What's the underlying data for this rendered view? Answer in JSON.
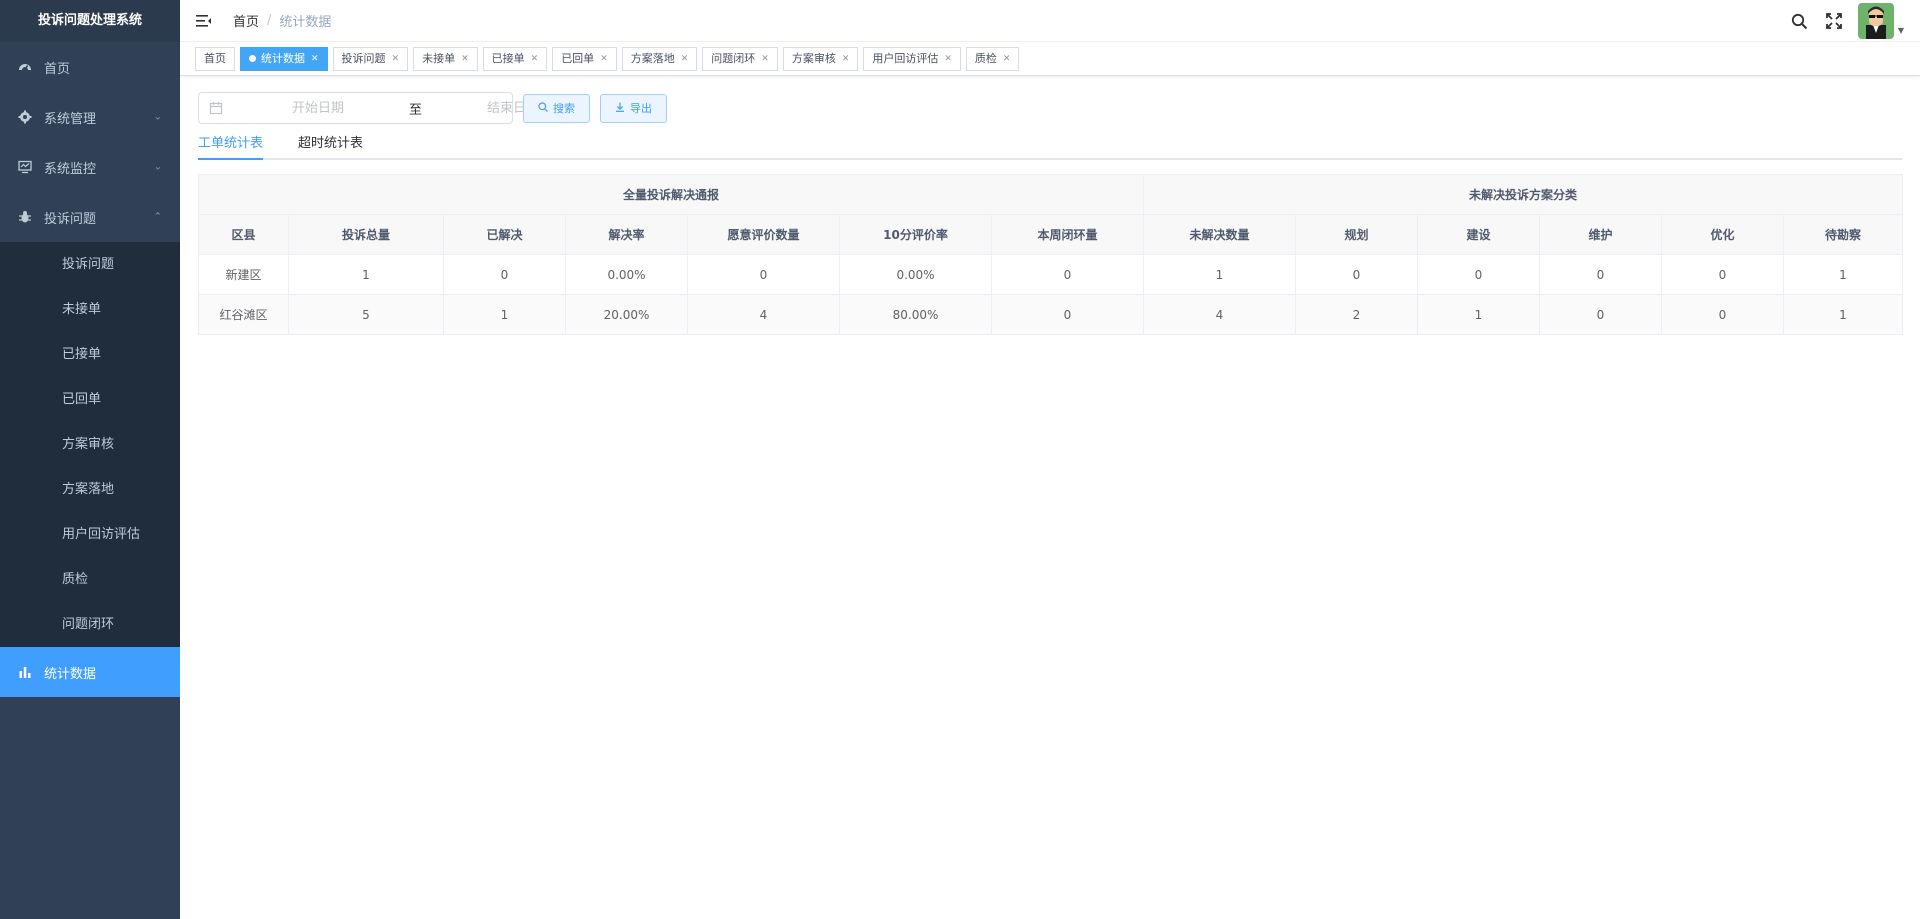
{
  "app": {
    "title": "投诉问题处理系统"
  },
  "sidebar": {
    "items": [
      {
        "label": "首页",
        "icon": "dashboard-icon"
      },
      {
        "label": "系统管理",
        "icon": "gear-icon"
      },
      {
        "label": "系统监控",
        "icon": "monitor-icon"
      },
      {
        "label": "投诉问题",
        "icon": "bug-icon"
      }
    ],
    "sub_items": [
      {
        "label": "投诉问题"
      },
      {
        "label": "未接单"
      },
      {
        "label": "已接单"
      },
      {
        "label": "已回单"
      },
      {
        "label": "方案审核"
      },
      {
        "label": "方案落地"
      },
      {
        "label": "用户回访评估"
      },
      {
        "label": "质检"
      },
      {
        "label": "问题闭环"
      }
    ],
    "active_item": {
      "label": "统计数据",
      "icon": "bar-chart-icon"
    }
  },
  "header": {
    "breadcrumb": {
      "home": "首页",
      "separator": "/",
      "current": "统计数据"
    }
  },
  "tags": [
    {
      "label": "首页",
      "closable": false,
      "active": false
    },
    {
      "label": "统计数据",
      "closable": true,
      "active": true
    },
    {
      "label": "投诉问题",
      "closable": true,
      "active": false
    },
    {
      "label": "未接单",
      "closable": true,
      "active": false
    },
    {
      "label": "已接单",
      "closable": true,
      "active": false
    },
    {
      "label": "已回单",
      "closable": true,
      "active": false
    },
    {
      "label": "方案落地",
      "closable": true,
      "active": false
    },
    {
      "label": "问题闭环",
      "closable": true,
      "active": false
    },
    {
      "label": "方案审核",
      "closable": true,
      "active": false
    },
    {
      "label": "用户回访评估",
      "closable": true,
      "active": false
    },
    {
      "label": "质检",
      "closable": true,
      "active": false
    }
  ],
  "filter": {
    "start_placeholder": "开始日期",
    "range_separator": "至",
    "end_placeholder": "结束日期",
    "search_label": "搜索",
    "export_label": "导出"
  },
  "tabs": [
    {
      "label": "工单统计表",
      "active": true
    },
    {
      "label": "超时统计表",
      "active": false
    }
  ],
  "table": {
    "group_headers": [
      {
        "label": "全量投诉解决通报",
        "colspan": 7
      },
      {
        "label": "未解决投诉方案分类",
        "colspan": 6
      }
    ],
    "columns": [
      "区县",
      "投诉总量",
      "已解决",
      "解决率",
      "愿意评价数量",
      "10分评价率",
      "本周闭环量",
      "未解决数量",
      "规划",
      "建设",
      "维护",
      "优化",
      "待勘察"
    ],
    "rows": [
      [
        "新建区",
        "1",
        "0",
        "0.00%",
        "0",
        "0.00%",
        "0",
        "1",
        "0",
        "0",
        "0",
        "0",
        "1"
      ],
      [
        "红谷滩区",
        "5",
        "1",
        "20.00%",
        "4",
        "80.00%",
        "0",
        "4",
        "2",
        "1",
        "0",
        "0",
        "1"
      ]
    ]
  },
  "colors": {
    "sidebar_bg": "#304156",
    "submenu_bg": "#1f2d3d",
    "accent": "#409eff",
    "active_tag": "#42a5f5"
  }
}
